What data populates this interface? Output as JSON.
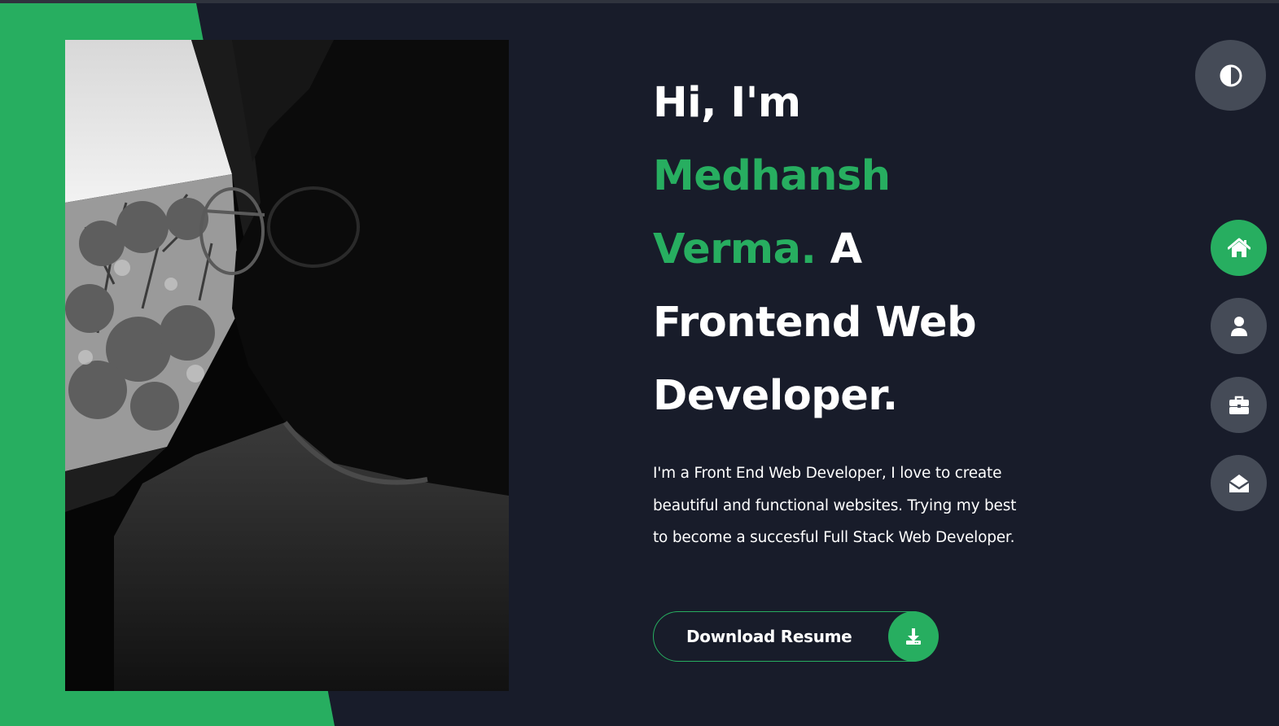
{
  "hero": {
    "greeting": "Hi, I'm",
    "name_first": "Medhansh",
    "name_last": "Verma.",
    "role_article": "A",
    "role": "Frontend Web Developer.",
    "description": "I'm a Front End Web Developer, I love to create beautiful and functional websites. Trying my best to become a succesful Full Stack Web Developer.",
    "button_label": "Download Resume",
    "button_icon": "download-icon"
  },
  "controls": {
    "theme_icon": "half-circle-contrast-icon"
  },
  "nav": [
    {
      "id": "home",
      "icon": "home-icon",
      "active": true
    },
    {
      "id": "about",
      "icon": "user-icon",
      "active": false
    },
    {
      "id": "portfolio",
      "icon": "briefcase-icon",
      "active": false
    },
    {
      "id": "contact",
      "icon": "envelope-open-icon",
      "active": false
    }
  ],
  "colors": {
    "background": "#181c2a",
    "accent": "#27ae60",
    "control_grey": "#454b57",
    "text": "#ffffff"
  }
}
